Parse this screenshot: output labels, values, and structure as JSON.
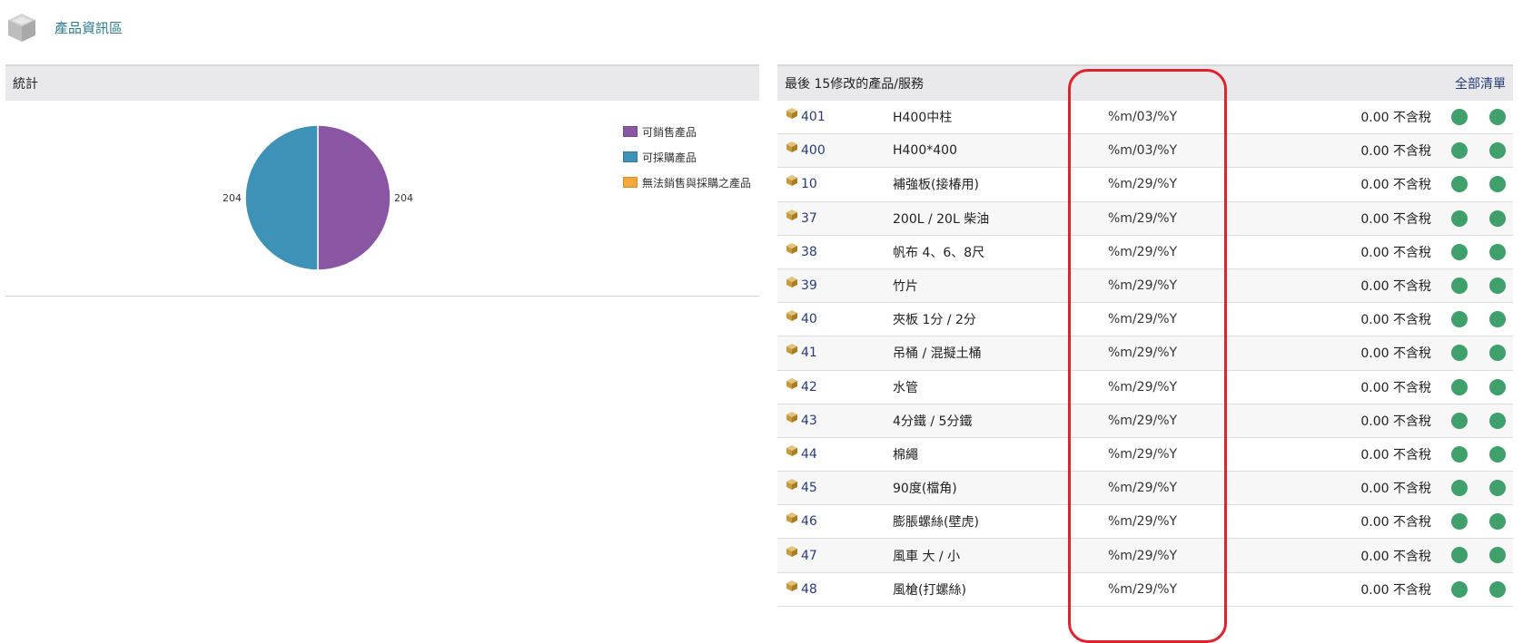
{
  "header": {
    "title": "產品資訊區",
    "icon": "cube-icon"
  },
  "stats": {
    "title": "統計",
    "chart_data": {
      "type": "pie",
      "title": "",
      "slices": [
        {
          "name": "可銷售產品",
          "value": 204,
          "color": "#8a55a2"
        },
        {
          "name": "可採購產品",
          "value": 204,
          "color": "#3e92b8"
        },
        {
          "name": "無法銷售與採購之產品",
          "value": 0,
          "color": "#f4a93a"
        }
      ],
      "data_labels": [
        "204",
        "204"
      ],
      "legend_position": "top-right"
    }
  },
  "recent": {
    "title": "最後 15修改的產品/服務",
    "all_link": "全部清單",
    "status_color": "#3fa06b",
    "rows": [
      {
        "ref": "401",
        "label": "H400中柱",
        "date": "%m/03/%Y",
        "price": "0.00 不含稅"
      },
      {
        "ref": "400",
        "label": "H400*400",
        "date": "%m/03/%Y",
        "price": "0.00 不含稅"
      },
      {
        "ref": "10",
        "label": "補強板(接椿用)",
        "date": "%m/29/%Y",
        "price": "0.00 不含稅"
      },
      {
        "ref": "37",
        "label": "200L / 20L 柴油",
        "date": "%m/29/%Y",
        "price": "0.00 不含稅"
      },
      {
        "ref": "38",
        "label": "帆布 4、6、8尺",
        "date": "%m/29/%Y",
        "price": "0.00 不含稅"
      },
      {
        "ref": "39",
        "label": "竹片",
        "date": "%m/29/%Y",
        "price": "0.00 不含稅"
      },
      {
        "ref": "40",
        "label": "夾板 1分 / 2分",
        "date": "%m/29/%Y",
        "price": "0.00 不含稅"
      },
      {
        "ref": "41",
        "label": "吊桶 / 混擬土桶",
        "date": "%m/29/%Y",
        "price": "0.00 不含稅"
      },
      {
        "ref": "42",
        "label": "水管",
        "date": "%m/29/%Y",
        "price": "0.00 不含稅"
      },
      {
        "ref": "43",
        "label": "4分鐵 / 5分鐵",
        "date": "%m/29/%Y",
        "price": "0.00 不含稅"
      },
      {
        "ref": "44",
        "label": "棉繩",
        "date": "%m/29/%Y",
        "price": "0.00 不含稅"
      },
      {
        "ref": "45",
        "label": "90度(檔角)",
        "date": "%m/29/%Y",
        "price": "0.00 不含稅"
      },
      {
        "ref": "46",
        "label": "膨脹螺絲(壁虎)",
        "date": "%m/29/%Y",
        "price": "0.00 不含稅"
      },
      {
        "ref": "47",
        "label": "風車 大 / 小",
        "date": "%m/29/%Y",
        "price": "0.00 不含稅"
      },
      {
        "ref": "48",
        "label": "風槍(打螺絲)",
        "date": "%m/29/%Y",
        "price": "0.00 不含稅"
      }
    ]
  }
}
